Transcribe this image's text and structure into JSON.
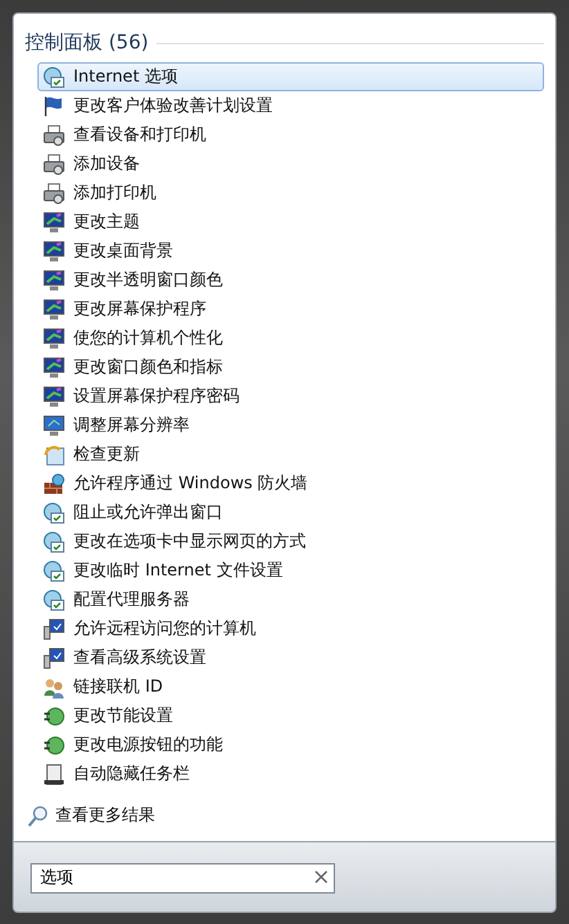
{
  "group": {
    "title": "控制面板 (56)"
  },
  "results": [
    {
      "label": "Internet 选项",
      "kind": "internet",
      "selected": true
    },
    {
      "label": "更改客户体验改善计划设置",
      "kind": "flag",
      "selected": false
    },
    {
      "label": "查看设备和打印机",
      "kind": "printer",
      "selected": false
    },
    {
      "label": "添加设备",
      "kind": "printer",
      "selected": false
    },
    {
      "label": "添加打印机",
      "kind": "printer",
      "selected": false
    },
    {
      "label": "更改主题",
      "kind": "display",
      "selected": false
    },
    {
      "label": "更改桌面背景",
      "kind": "display",
      "selected": false
    },
    {
      "label": "更改半透明窗口颜色",
      "kind": "display",
      "selected": false
    },
    {
      "label": "更改屏幕保护程序",
      "kind": "display",
      "selected": false
    },
    {
      "label": "使您的计算机个性化",
      "kind": "display",
      "selected": false
    },
    {
      "label": "更改窗口颜色和指标",
      "kind": "display",
      "selected": false
    },
    {
      "label": "设置屏幕保护程序密码",
      "kind": "display",
      "selected": false
    },
    {
      "label": "调整屏幕分辨率",
      "kind": "monitor",
      "selected": false
    },
    {
      "label": "检查更新",
      "kind": "update",
      "selected": false
    },
    {
      "label": "允许程序通过 Windows 防火墙",
      "kind": "firewall",
      "selected": false
    },
    {
      "label": "阻止或允许弹出窗口",
      "kind": "internet",
      "selected": false
    },
    {
      "label": "更改在选项卡中显示网页的方式",
      "kind": "internet",
      "selected": false
    },
    {
      "label": "更改临时 Internet 文件设置",
      "kind": "internet",
      "selected": false
    },
    {
      "label": "配置代理服务器",
      "kind": "internet",
      "selected": false
    },
    {
      "label": "允许远程访问您的计算机",
      "kind": "system",
      "selected": false
    },
    {
      "label": "查看高级系统设置",
      "kind": "system",
      "selected": false
    },
    {
      "label": "链接联机 ID",
      "kind": "users",
      "selected": false
    },
    {
      "label": "更改节能设置",
      "kind": "power",
      "selected": false
    },
    {
      "label": "更改电源按钮的功能",
      "kind": "power",
      "selected": false
    },
    {
      "label": "自动隐藏任务栏",
      "kind": "taskbar",
      "selected": false
    }
  ],
  "more_results": "查看更多结果",
  "search": {
    "value": "选项"
  }
}
